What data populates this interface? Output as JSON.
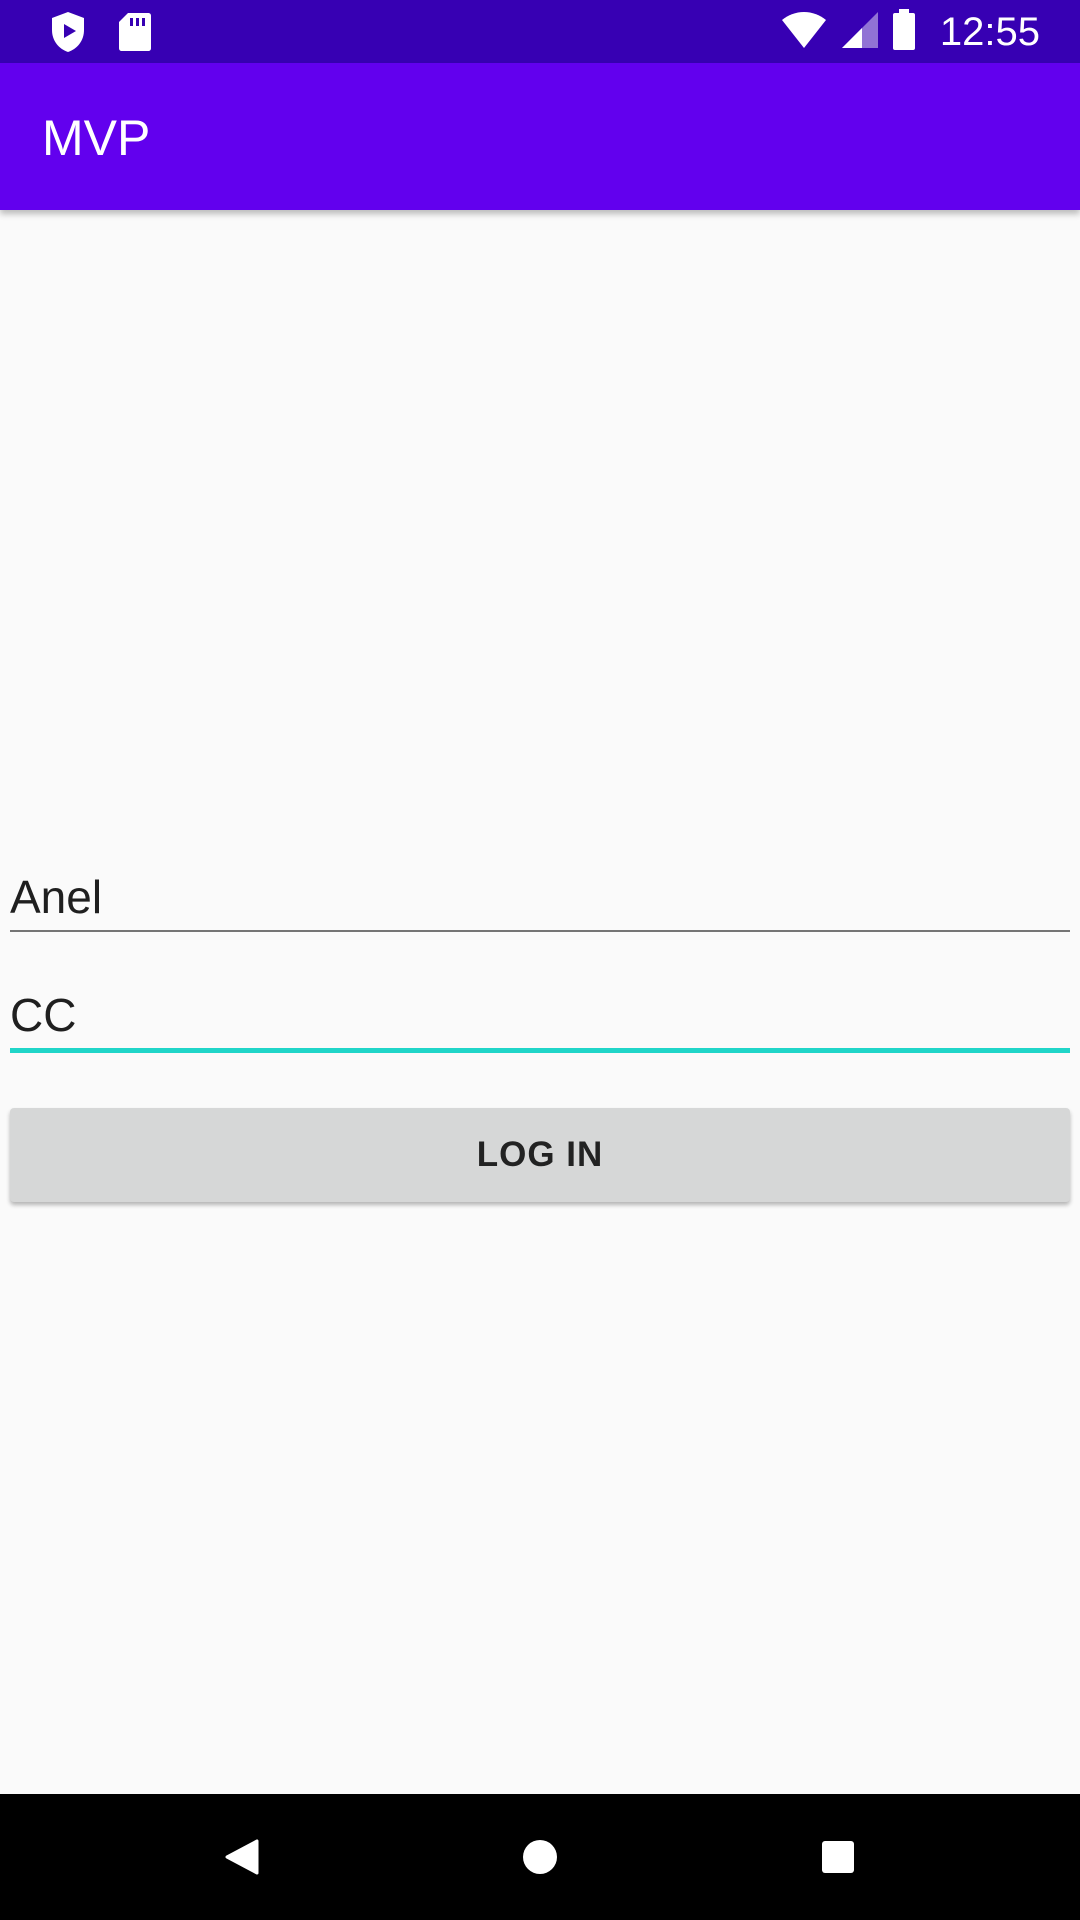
{
  "status_bar": {
    "time": "12:55",
    "left_icons": [
      "play-protect-icon",
      "sd-card-icon"
    ],
    "right_icons": [
      "wifi-icon",
      "cell-signal-icon",
      "battery-icon"
    ]
  },
  "app_bar": {
    "title": "MVP"
  },
  "form": {
    "username_value": "Anel",
    "password_value": "CC",
    "login_label": "LOG IN"
  },
  "nav_bar": {
    "icons": [
      "back-icon",
      "home-icon",
      "recents-icon"
    ]
  },
  "colors": {
    "status_bar": "#3700b3",
    "app_bar": "#6200ee",
    "focus_accent": "#20d5c8",
    "button": "#d6d7d7",
    "background": "#fafafa"
  }
}
